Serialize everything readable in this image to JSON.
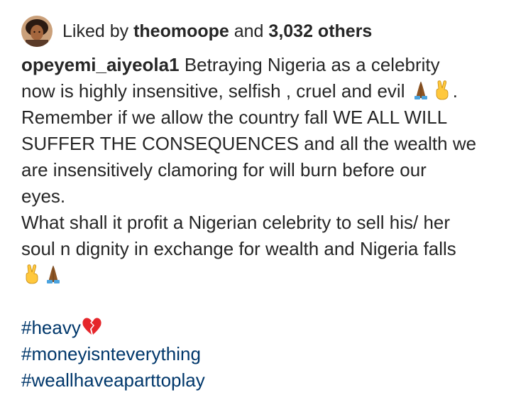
{
  "likes": {
    "prefix": "Liked by",
    "user": "theomoope",
    "middle": "and",
    "others": "3,032 others"
  },
  "post": {
    "username": "opeyemi_aiyeola1",
    "lines": [
      "Betraying Nigeria as a celebrity",
      "now is highly insensitive, selfish , cruel and evil",
      ".",
      "Remember if we allow the country fall WE ALL WILL",
      "SUFFER THE CONSEQUENCES and all the wealth we",
      "are insensitively clamoring for will burn before our",
      "eyes.",
      "What shall it profit a Nigerian celebrity to sell his/ her",
      "soul n dignity in exchange for wealth and Nigeria falls"
    ],
    "hashtags": [
      "#heavy",
      "#moneyisnteverything",
      "#weallhaveaparttoplay"
    ]
  },
  "icons": [
    "praying-hands-icon",
    "victory-hand-icon",
    "broken-heart-icon"
  ],
  "colors": {
    "text": "#262626",
    "hashtag": "#00376b",
    "emoji_skin": "#8d5524",
    "emoji_victory": "#ffc83d",
    "emoji_sleeve": "#4aa3df",
    "broken_heart": "#e5262b"
  }
}
